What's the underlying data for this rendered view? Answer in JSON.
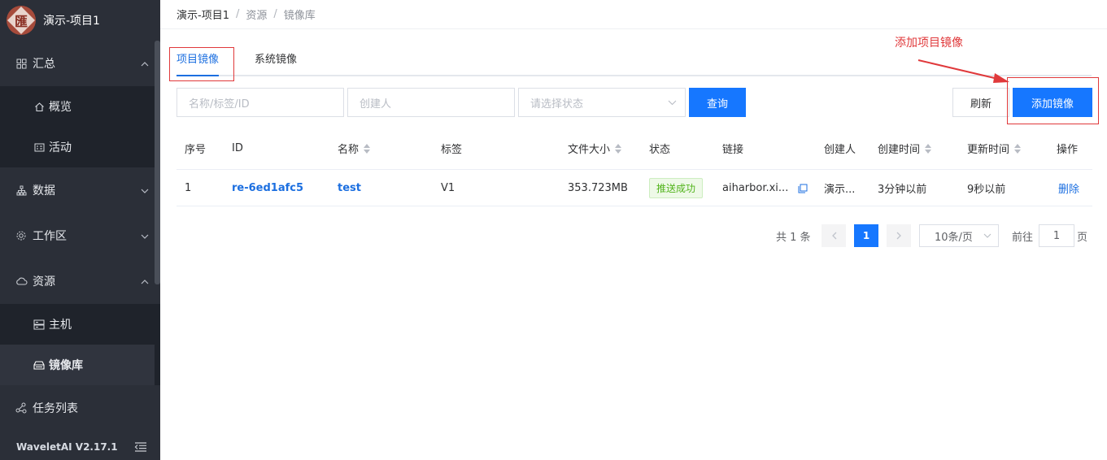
{
  "app": {
    "title": "演示-项目1",
    "version": "WaveletAI V2.17.1"
  },
  "sidebar": {
    "groups": [
      {
        "label": "汇总",
        "icon": "grid-icon",
        "chevron": "^"
      },
      {
        "label": "数据",
        "icon": "data-tree-icon",
        "chevron": "v"
      },
      {
        "label": "工作区",
        "icon": "gear-icon",
        "chevron": "v"
      },
      {
        "label": "资源",
        "icon": "cloud-icon",
        "chevron": "^"
      },
      {
        "label": "任务列表",
        "icon": "nodes-icon"
      }
    ],
    "summary_items": [
      {
        "label": "概览",
        "icon": "home-icon"
      },
      {
        "label": "活动",
        "icon": "activity-icon"
      }
    ],
    "resource_items": [
      {
        "label": "主机",
        "icon": "server-icon"
      },
      {
        "label": "镜像库",
        "icon": "image-repo-icon",
        "active": true
      }
    ]
  },
  "breadcrumb": {
    "items": [
      "演示-项目1",
      "资源",
      "镜像库"
    ],
    "separator": "/"
  },
  "tabs": {
    "project": "项目镜像",
    "system": "系统镜像",
    "active": "project"
  },
  "filters": {
    "name_placeholder": "名称/标签/ID",
    "creator_placeholder": "创建人",
    "status_placeholder": "请选择状态",
    "query_label": "查询",
    "refresh_label": "刷新",
    "add_label": "添加镜像"
  },
  "annotation": {
    "text": "添加项目镜像",
    "color": "#e0393b"
  },
  "table": {
    "columns": {
      "index": "序号",
      "id": "ID",
      "name": "名称",
      "tag": "标签",
      "size": "文件大小",
      "status": "状态",
      "link": "链接",
      "creator": "创建人",
      "created": "创建时间",
      "updated": "更新时间",
      "action": "操作"
    },
    "rows": [
      {
        "index": "1",
        "id": "re-6ed1afc5",
        "name": "test",
        "tag": "V1",
        "size": "353.723MB",
        "status": "推送成功",
        "link": "aiharbor.xi...",
        "creator": "演示...",
        "created": "3分钟以前",
        "updated": "9秒以前",
        "action": "删除"
      }
    ]
  },
  "pagination": {
    "total": "共 1 条",
    "current_page": "1",
    "page_size": "10条/页",
    "goto_prefix": "前往",
    "goto_value": "1",
    "goto_suffix": "页"
  },
  "colors": {
    "primary": "#1677ff",
    "sidebar": "#2b2f38",
    "success": "#52b41c"
  }
}
